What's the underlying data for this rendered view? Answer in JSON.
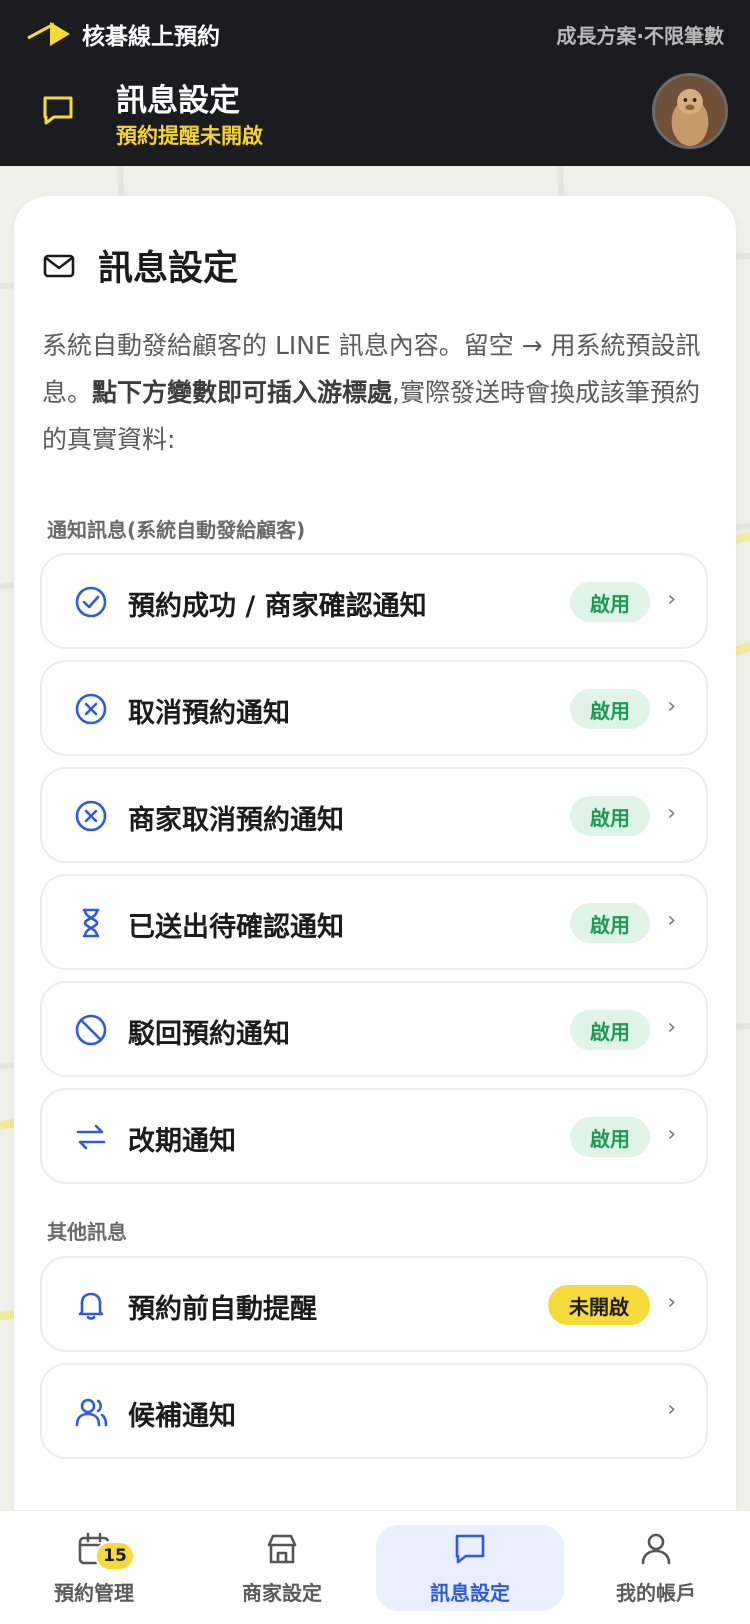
{
  "header": {
    "brand": "核碁線上預約",
    "plan": "成長方案·不限筆數",
    "title": "訊息設定",
    "subtitle": "預約提醒未開啟"
  },
  "card": {
    "title": "訊息設定",
    "desc_part1": "系統自動發給顧客的 LINE 訊息內容。留空 → 用系統預設訊息。",
    "desc_bold": "點下方變數即可插入游標處",
    "desc_part2": ",實際發送時會換成該筆預約的真實資料:"
  },
  "sections": {
    "notify_label": "通知訊息(系統自動發給顧客)",
    "other_label": "其他訊息"
  },
  "notify_items": [
    {
      "label": "預約成功 / 商家確認通知",
      "status": "啟用",
      "icon": "check-circle-icon"
    },
    {
      "label": "取消預約通知",
      "status": "啟用",
      "icon": "x-circle-icon"
    },
    {
      "label": "商家取消預約通知",
      "status": "啟用",
      "icon": "x-circle-icon"
    },
    {
      "label": "已送出待確認通知",
      "status": "啟用",
      "icon": "hourglass-icon"
    },
    {
      "label": "駁回預約通知",
      "status": "啟用",
      "icon": "ban-icon"
    },
    {
      "label": "改期通知",
      "status": "啟用",
      "icon": "swap-arrows-icon"
    }
  ],
  "other_items": [
    {
      "label": "預約前自動提醒",
      "status": "未開啟",
      "icon": "bell-icon"
    },
    {
      "label": "候補通知",
      "icon": "users-icon"
    }
  ],
  "chevron": "›",
  "nav": {
    "items": [
      {
        "label": "預約管理",
        "icon": "calendar-icon",
        "badge": "15"
      },
      {
        "label": "商家設定",
        "icon": "store-icon"
      },
      {
        "label": "訊息設定",
        "icon": "chat-icon",
        "active": true
      },
      {
        "label": "我的帳戶",
        "icon": "user-icon"
      }
    ]
  },
  "colors": {
    "header_bg": "#1b1c20",
    "accent_yellow": "#f6d93a",
    "accent_blue": "#2f5bd6",
    "enabled_green": "#1f9a55"
  }
}
